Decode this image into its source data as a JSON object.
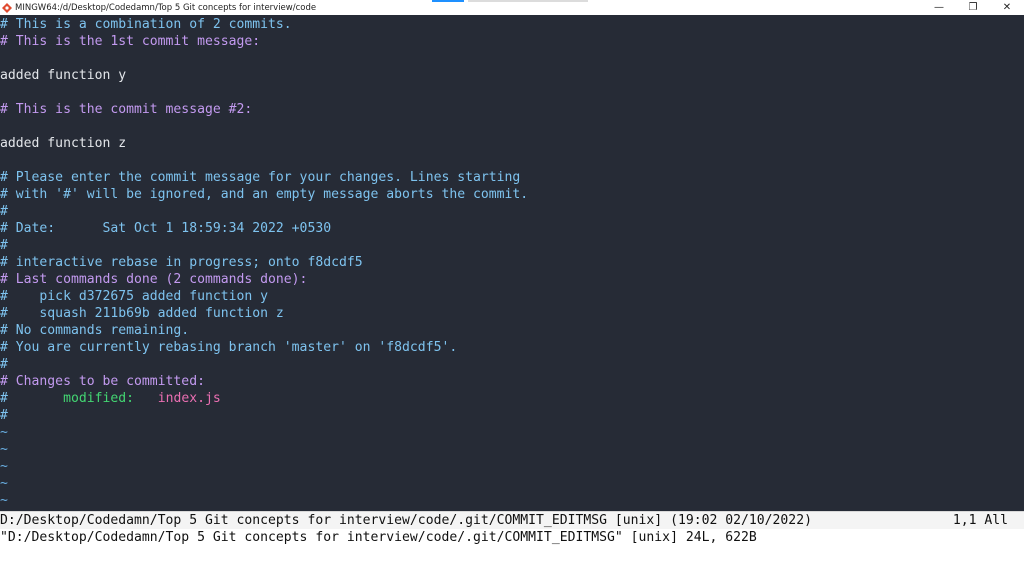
{
  "window": {
    "title": "MINGW64:/d/Desktop/Codedamn/Top 5 Git concepts for interview/code",
    "controls": [
      "—",
      "❐",
      "✕"
    ]
  },
  "editor": {
    "lines": [
      {
        "text": "# This is a combination of 2 commits.",
        "kind": "comment-blue"
      },
      {
        "text": "# This is the 1st commit message:",
        "kind": "comment"
      },
      {
        "text": "",
        "kind": "plain"
      },
      {
        "text": "added function y",
        "kind": "plain"
      },
      {
        "text": "",
        "kind": "plain"
      },
      {
        "text": "# This is the commit message #2:",
        "kind": "comment"
      },
      {
        "text": "",
        "kind": "plain"
      },
      {
        "text": "added function z",
        "kind": "plain"
      },
      {
        "text": "",
        "kind": "plain"
      },
      {
        "text": "# Please enter the commit message for your changes. Lines starting",
        "kind": "comment-blue"
      },
      {
        "text": "# with '#' will be ignored, and an empty message aborts the commit.",
        "kind": "comment-blue"
      },
      {
        "text": "#",
        "kind": "comment-blue"
      },
      {
        "text": "# Date:      Sat Oct 1 18:59:34 2022 +0530",
        "kind": "comment-blue"
      },
      {
        "text": "#",
        "kind": "comment-blue"
      },
      {
        "text": "# interactive rebase in progress; onto f8dcdf5",
        "kind": "comment-blue"
      },
      {
        "text": "# Last commands done (2 commands done):",
        "kind": "comment"
      },
      {
        "text": "#    pick d372675 added function y",
        "kind": "comment-blue"
      },
      {
        "text": "#    squash 211b69b added function z",
        "kind": "comment-blue"
      },
      {
        "text": "# No commands remaining.",
        "kind": "comment-blue"
      },
      {
        "text": "# You are currently rebasing branch 'master' on 'f8dcdf5'.",
        "kind": "comment-blue"
      },
      {
        "text": "#",
        "kind": "comment-blue"
      },
      {
        "text": "# Changes to be committed:",
        "kind": "comment"
      },
      {
        "text": "",
        "kind": "modified",
        "prefix": "#       ",
        "keyword": "modified:",
        "gap": "   ",
        "file": "index.js"
      },
      {
        "text": "#",
        "kind": "comment-blue"
      },
      {
        "text": "~",
        "kind": "tilde"
      },
      {
        "text": "~",
        "kind": "tilde"
      },
      {
        "text": "~",
        "kind": "tilde"
      },
      {
        "text": "~",
        "kind": "tilde"
      },
      {
        "text": "~",
        "kind": "tilde"
      }
    ]
  },
  "status": {
    "path": "D:/Desktop/Codedamn/Top 5 Git concepts for interview/code/.git/COMMIT_EDITMSG [unix] (19:02 02/10/2022)",
    "position": "1,1 All"
  },
  "message": "\"D:/Desktop/Codedamn/Top 5 Git concepts for interview/code/.git/COMMIT_EDITMSG\" [unix] 24L, 622B",
  "colors": {
    "background": "#262b36",
    "comment": "#c39af0",
    "comment_blue": "#7ec3ef",
    "keyword": "#43d672",
    "file": "#ea6fb2",
    "tilde": "#6ab0e4"
  }
}
